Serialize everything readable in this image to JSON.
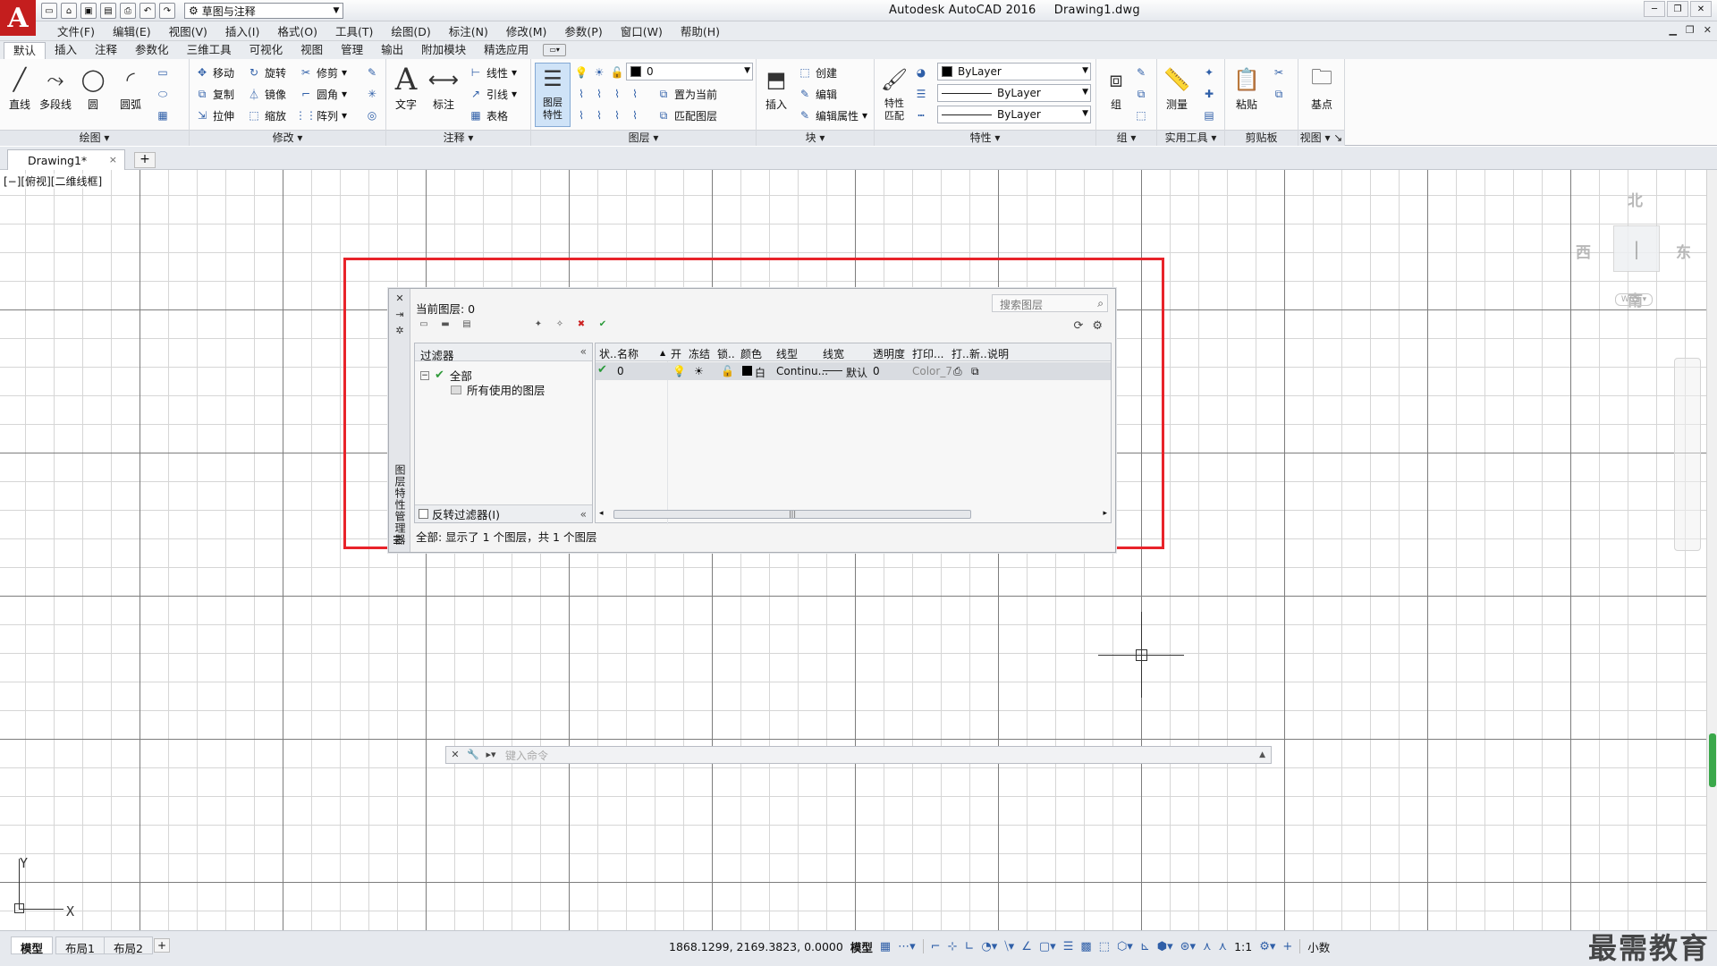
{
  "app": {
    "logo": "A",
    "title": "Autodesk AutoCAD 2016",
    "filename": "Drawing1.dwg",
    "workspace": "草图与注释"
  },
  "menu": [
    "文件(F)",
    "编辑(E)",
    "视图(V)",
    "插入(I)",
    "格式(O)",
    "工具(T)",
    "绘图(D)",
    "标注(N)",
    "修改(M)",
    "参数(P)",
    "窗口(W)",
    "帮助(H)"
  ],
  "ribbon_tabs": [
    "默认",
    "插入",
    "注释",
    "参数化",
    "三维工具",
    "可视化",
    "视图",
    "管理",
    "输出",
    "附加模块",
    "精选应用"
  ],
  "ribbon": {
    "draw": {
      "title": "绘图",
      "line": "直线",
      "polyline": "多段线",
      "circle": "圆",
      "arc": "圆弧"
    },
    "modify": {
      "title": "修改",
      "move": "移动",
      "rotate": "旋转",
      "trim": "修剪",
      "copy": "复制",
      "mirror": "镜像",
      "fillet": "圆角",
      "stretch": "拉伸",
      "scale": "缩放",
      "array": "阵列"
    },
    "annotation": {
      "title": "注释",
      "text": "文字",
      "dimension": "标注",
      "linear": "线性",
      "leader": "引线",
      "table": "表格"
    },
    "layers": {
      "title": "图层",
      "props": "图层\n特性",
      "current_layer": "0",
      "set_current": "置为当前",
      "match_layer": "匹配图层"
    },
    "block": {
      "title": "块",
      "insert": "插入",
      "create": "创建",
      "edit": "编辑",
      "edit_attr": "编辑属性"
    },
    "properties": {
      "title": "特性",
      "match": "特性\n匹配",
      "color": "ByLayer",
      "linetype": "ByLayer",
      "lineweight": "ByLayer"
    },
    "group": {
      "title": "组",
      "group": "组"
    },
    "utilities": {
      "title": "实用工具",
      "measure": "测量"
    },
    "clipboard": {
      "title": "剪贴板",
      "paste": "粘贴"
    },
    "view": {
      "title": "视图",
      "base": "基点"
    }
  },
  "doc_tab": {
    "name": "Drawing1*",
    "close": "×"
  },
  "viewport_label": "[−][俯视][二维线框]",
  "viewcube": {
    "north": "北",
    "south": "南",
    "east": "东",
    "west": "西",
    "wcs": "WCS"
  },
  "layer_manager": {
    "current_layer": "当前图层: 0",
    "search_placeholder": "搜索图层",
    "filters_header": "过滤器",
    "tree_all": "全部",
    "tree_used": "所有使用的图层",
    "invert_filter": "反转过滤器(I)",
    "side_title": "图层特性管理器",
    "columns": [
      "状..",
      "名称",
      "开",
      "冻结",
      "锁..",
      "颜色",
      "线型",
      "线宽",
      "透明度",
      "打印...",
      "打..",
      "新..",
      "说明"
    ],
    "row": {
      "name": "0",
      "color": "白",
      "linetype": "Continu...",
      "lineweight": "默认",
      "transparency": "0",
      "plot_style": "Color_7"
    },
    "status": "全部: 显示了 1 个图层，共 1 个图层"
  },
  "ucs": {
    "x": "X",
    "y": "Y"
  },
  "command_line": {
    "placeholder": "键入命令"
  },
  "layout_tabs": [
    "模型",
    "布局1",
    "布局2"
  ],
  "status": {
    "coords": "1868.1299, 2169.3823, 0.0000",
    "space": "模型",
    "scale": "1:1",
    "units": "小数"
  },
  "watermark": "最需教育"
}
